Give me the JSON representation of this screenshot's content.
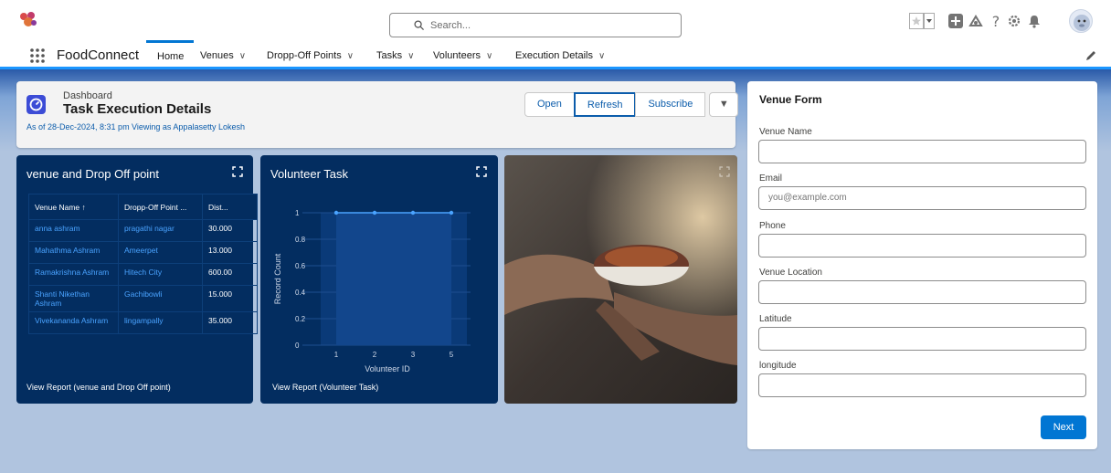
{
  "header": {
    "search_placeholder": "Search...",
    "icons": [
      "favorites-star-icon",
      "favorites-dropdown-icon",
      "add-icon",
      "trailhead-icon",
      "help-icon",
      "setup-gear-icon",
      "notifications-bell-icon",
      "user-avatar"
    ]
  },
  "nav": {
    "app_name": "FoodConnect",
    "items": [
      {
        "label": "Home"
      },
      {
        "label": "Venues"
      },
      {
        "label": "Dropp-Off Points"
      },
      {
        "label": "Tasks"
      },
      {
        "label": "Volunteers"
      },
      {
        "label": "Execution Details"
      }
    ]
  },
  "dashboard": {
    "type_label": "Dashboard",
    "title": "Task Execution Details",
    "meta": "As of 28-Dec-2024, 8:31 pm Viewing as Appalasetty Lokesh",
    "buttons": {
      "open": "Open",
      "refresh": "Refresh",
      "subscribe": "Subscribe",
      "dropdown": "▼"
    }
  },
  "venue_widget": {
    "title": "venue and Drop Off point",
    "columns": [
      "Venue Name ↑",
      "Dropp-Off Point ...",
      "Dist..."
    ],
    "rows": [
      {
        "venue": "anna ashram",
        "drop": "pragathi nagar",
        "dist": "30.000"
      },
      {
        "venue": "Mahathma Ashram",
        "drop": "Ameerpet",
        "dist": "13.000"
      },
      {
        "venue": "Ramakrishna Ashram",
        "drop": "Hitech City",
        "dist": "600.00"
      },
      {
        "venue": "Shanti Nikethan Ashram",
        "drop": "Gachibowli",
        "dist": "15.000"
      },
      {
        "venue": "Vivekananda Ashram",
        "drop": "lingampally",
        "dist": "35.000"
      }
    ],
    "footer": "View Report (venue and Drop Off point)"
  },
  "volunteer_widget": {
    "title": "Volunteer Task",
    "footer": "View Report (Volunteer Task)"
  },
  "chart_data": {
    "type": "area",
    "categories": [
      "1",
      "2",
      "3",
      "5"
    ],
    "values": [
      1,
      1,
      1,
      1
    ],
    "xlabel": "Volunteer ID",
    "ylabel": "Record Count",
    "ylim": [
      0,
      1
    ],
    "yticks": [
      "0",
      "0.2",
      "0.4",
      "0.6",
      "0.8",
      "1"
    ],
    "grid": true,
    "color": "#4aa3ff"
  },
  "form": {
    "title": "Venue Form",
    "fields": [
      {
        "label": "Venue Name",
        "placeholder": ""
      },
      {
        "label": "Email",
        "placeholder": "you@example.com"
      },
      {
        "label": "Phone",
        "placeholder": ""
      },
      {
        "label": "Venue Location",
        "placeholder": ""
      },
      {
        "label": "Latitude",
        "placeholder": ""
      },
      {
        "label": "longitude",
        "placeholder": ""
      }
    ],
    "next_label": "Next"
  },
  "colors": {
    "brand_blue": "#0176d3",
    "widget_dark": "#032d60",
    "link_blue": "#0b5cab"
  }
}
